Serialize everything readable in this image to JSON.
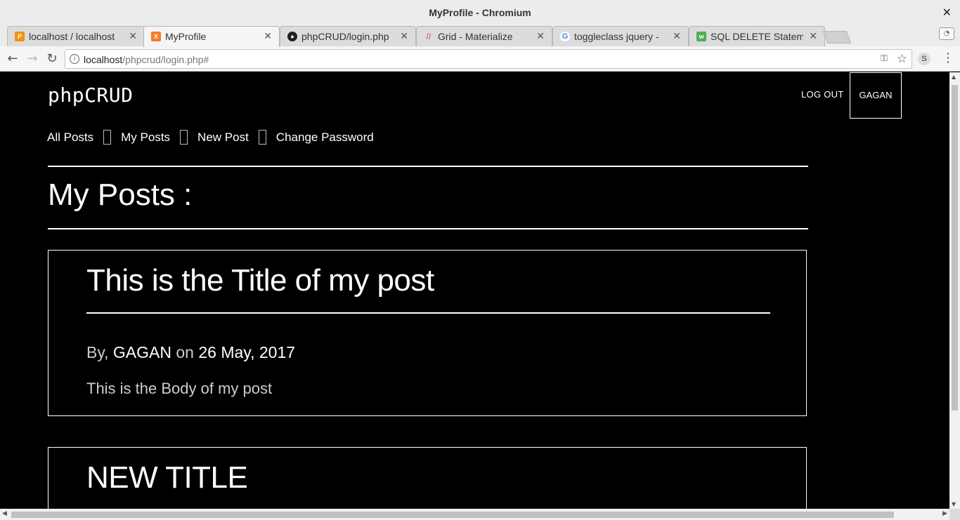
{
  "window": {
    "title": "MyProfile - Chromium"
  },
  "tabs": [
    {
      "label": "localhost / localhost",
      "favicon": "phpmyadmin-icon",
      "active": false
    },
    {
      "label": "MyProfile",
      "favicon": "xampp-icon",
      "active": true
    },
    {
      "label": "phpCRUD/login.php",
      "favicon": "github-icon",
      "active": false
    },
    {
      "label": "Grid - Materialize",
      "favicon": "materialize-icon",
      "active": false
    },
    {
      "label": "toggleclass jquery -",
      "favicon": "google-icon",
      "active": false
    },
    {
      "label": "SQL DELETE Statem",
      "favicon": "w3schools-icon",
      "active": false
    }
  ],
  "address": {
    "host": "localhost",
    "path": "/phpcrud/login.php#"
  },
  "site": {
    "brand": "phpCRUD",
    "logout": "LOG OUT",
    "user": "GAGAN",
    "nav": [
      "All Posts",
      "My Posts",
      "New Post",
      "Change Password"
    ],
    "heading": "My Posts :"
  },
  "posts": [
    {
      "title": "This is the Title of my post",
      "by_label": "By,",
      "author": "GAGAN",
      "on_label": "on",
      "date": "26 May, 2017",
      "body": "This is the Body of my post"
    },
    {
      "title": "NEW TITLE"
    }
  ],
  "colors": {
    "page_bg": "#000000",
    "text": "#ffffff",
    "muted": "#cccccc",
    "chrome": "#ececec"
  }
}
